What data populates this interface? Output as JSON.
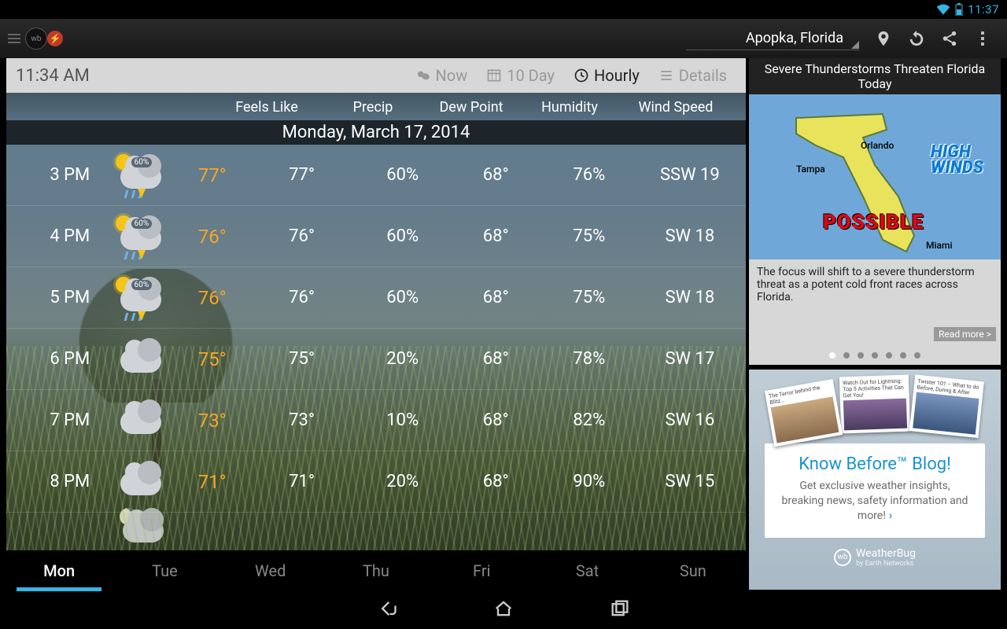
{
  "status": {
    "time": "11:37"
  },
  "actionbar": {
    "location": "Apopka, Florida"
  },
  "viewbar": {
    "time": "11:34 AM",
    "now": "Now",
    "tenday": "10 Day",
    "hourly": "Hourly",
    "details": "Details"
  },
  "columns": {
    "feels": "Feels Like",
    "precip": "Precip",
    "dew": "Dew Point",
    "humidity": "Humidity",
    "wind": "Wind Speed"
  },
  "date": "Monday, March 17, 2014",
  "hours": [
    {
      "time": "3 PM",
      "icon": "tstorm",
      "pop": "60%",
      "temp": "77°",
      "feels": "77°",
      "precip": "60%",
      "dew": "68°",
      "hum": "76%",
      "wind": "SSW 19"
    },
    {
      "time": "4 PM",
      "icon": "tstorm",
      "pop": "60%",
      "temp": "76°",
      "feels": "76°",
      "precip": "60%",
      "dew": "68°",
      "hum": "75%",
      "wind": "SW 18"
    },
    {
      "time": "5 PM",
      "icon": "tstorm",
      "pop": "60%",
      "temp": "76°",
      "feels": "76°",
      "precip": "60%",
      "dew": "68°",
      "hum": "75%",
      "wind": "SW 18"
    },
    {
      "time": "6 PM",
      "icon": "cloudy",
      "pop": "",
      "temp": "75°",
      "feels": "75°",
      "precip": "20%",
      "dew": "68°",
      "hum": "78%",
      "wind": "SW 17"
    },
    {
      "time": "7 PM",
      "icon": "cloudy",
      "pop": "",
      "temp": "73°",
      "feels": "73°",
      "precip": "10%",
      "dew": "68°",
      "hum": "82%",
      "wind": "SW 16"
    },
    {
      "time": "8 PM",
      "icon": "cloudy",
      "pop": "",
      "temp": "71°",
      "feels": "71°",
      "precip": "20%",
      "dew": "68°",
      "hum": "90%",
      "wind": "SW 15"
    }
  ],
  "days": [
    "Mon",
    "Tue",
    "Wed",
    "Thu",
    "Fri",
    "Sat",
    "Sun"
  ],
  "active_day": 0,
  "news": {
    "headline": "Severe Thunderstorms Threaten Florida Today",
    "map": {
      "tampa": "Tampa",
      "orlando": "Orlando",
      "miami": "Miami",
      "highwinds_l1": "HIGH",
      "highwinds_l2": "WINDS",
      "possible": "POSSIBLE"
    },
    "body": "The focus will shift to a severe thunderstorm threat as a potent cold front races across Florida.",
    "readmore": "Read more >",
    "dot_count": 7,
    "active_dot": 0
  },
  "blog": {
    "thumbs": [
      "The Terror behind the Blitz...",
      "Watch Out for Lightning: Top 5 Activities That Can Get You!",
      "Twister 101 – What to do Before, During & After"
    ],
    "title": "Know Before™ Blog!",
    "sub": "Get exclusive weather insights, breaking news, safety information and more!",
    "brand": "WeatherBug",
    "brand_sub": "by Earth Networks"
  }
}
